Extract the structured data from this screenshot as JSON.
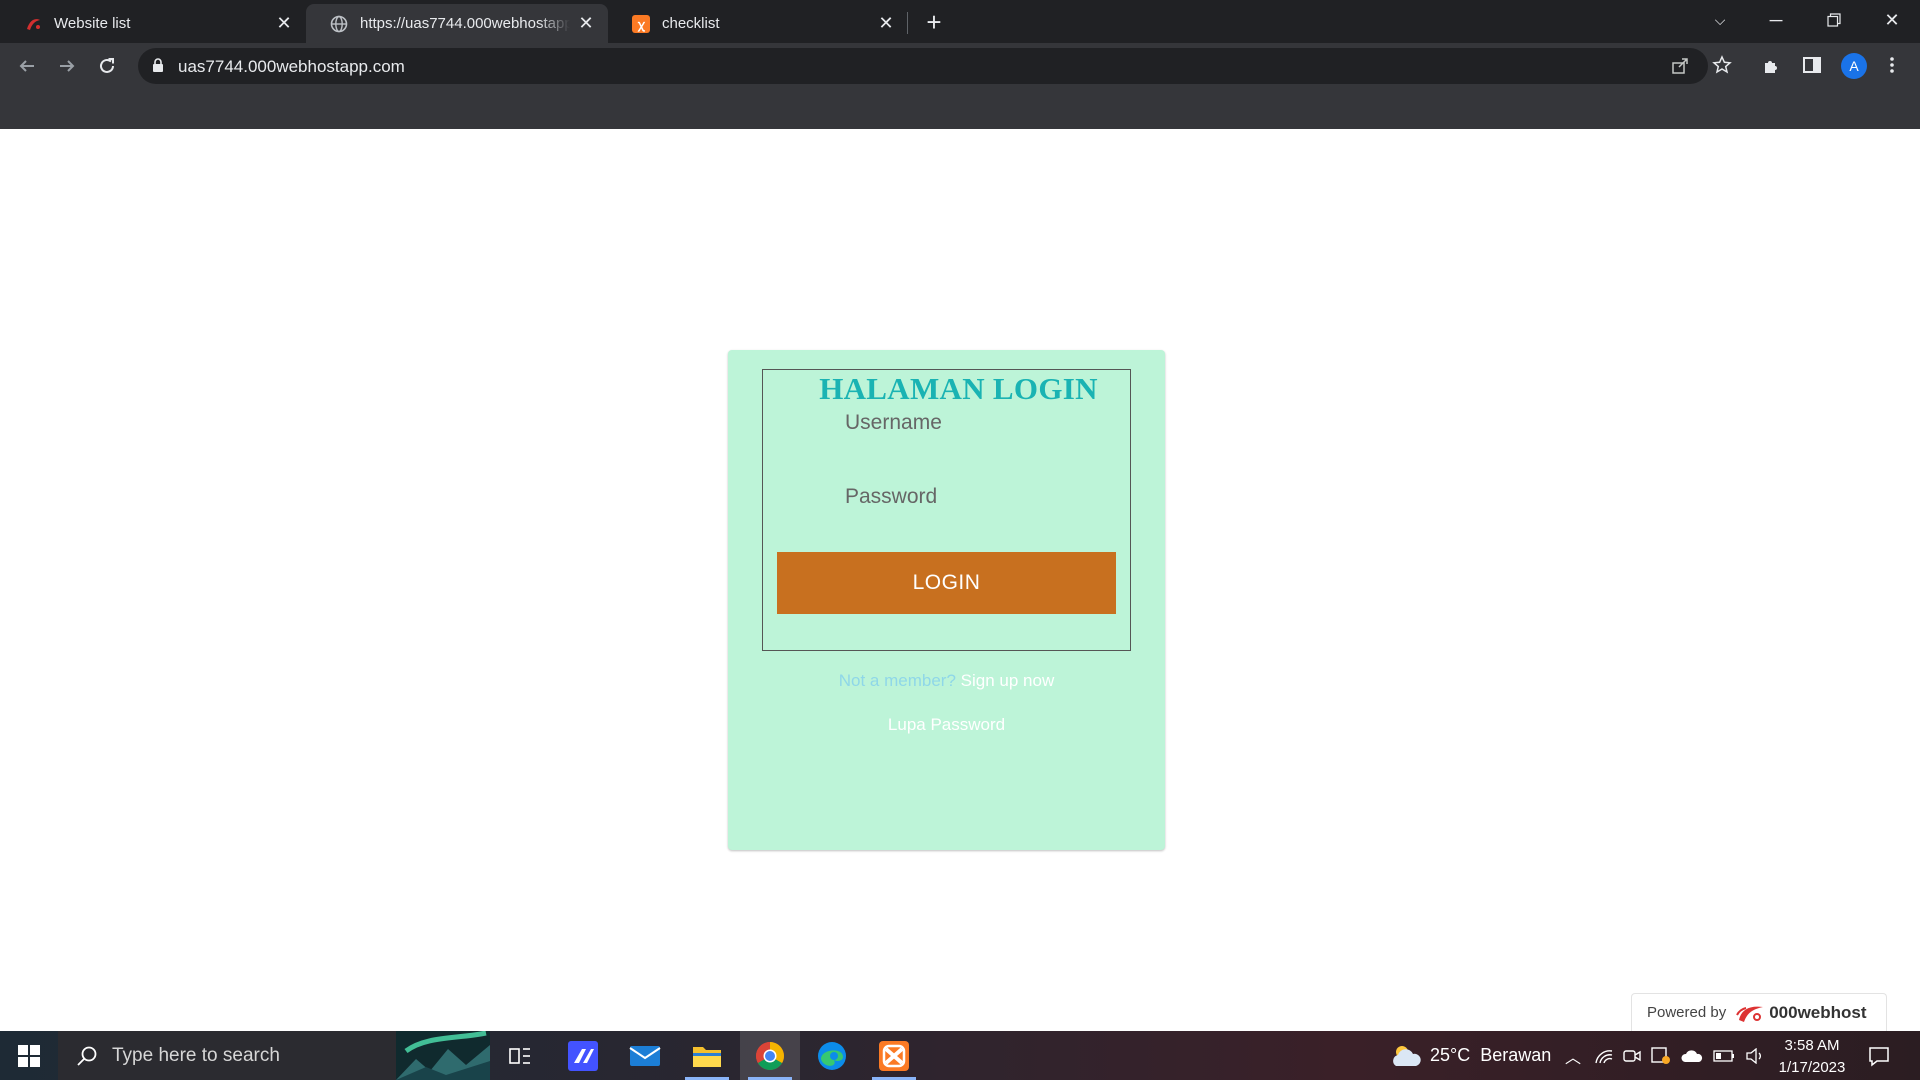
{
  "browser": {
    "tabs": [
      {
        "title": "Website list",
        "icon": "web-list-favicon"
      },
      {
        "title": "https://uas7744.000webhostapp.com",
        "icon": "globe-icon",
        "active": true
      },
      {
        "title": "checklist",
        "icon": "xampp-icon"
      }
    ],
    "address": "uas7744.000webhostapp.com",
    "profile_initial": "A"
  },
  "login": {
    "title": "HALAMAN LOGIN",
    "username_placeholder": "Username",
    "password_placeholder": "Password",
    "button_label": "LOGIN",
    "not_member_text": "Not a member?",
    "signup_link": "Sign up now",
    "forgot_link": "Lupa Password"
  },
  "colors": {
    "card_bg": "#bdf4d8",
    "title": "#1ab3b3",
    "button": "#c8701f"
  },
  "footer_badge": {
    "prefix": "Powered by",
    "brand": "000webhost"
  },
  "taskbar": {
    "search_placeholder": "Type here to search",
    "weather": "25°C  Berawan",
    "time": "3:58 AM",
    "date": "1/17/2023",
    "apps": [
      "task-view-icon",
      "visual-studio-icon",
      "mail-icon",
      "file-explorer-icon",
      "chrome-icon",
      "edge-icon",
      "xampp-icon"
    ]
  }
}
